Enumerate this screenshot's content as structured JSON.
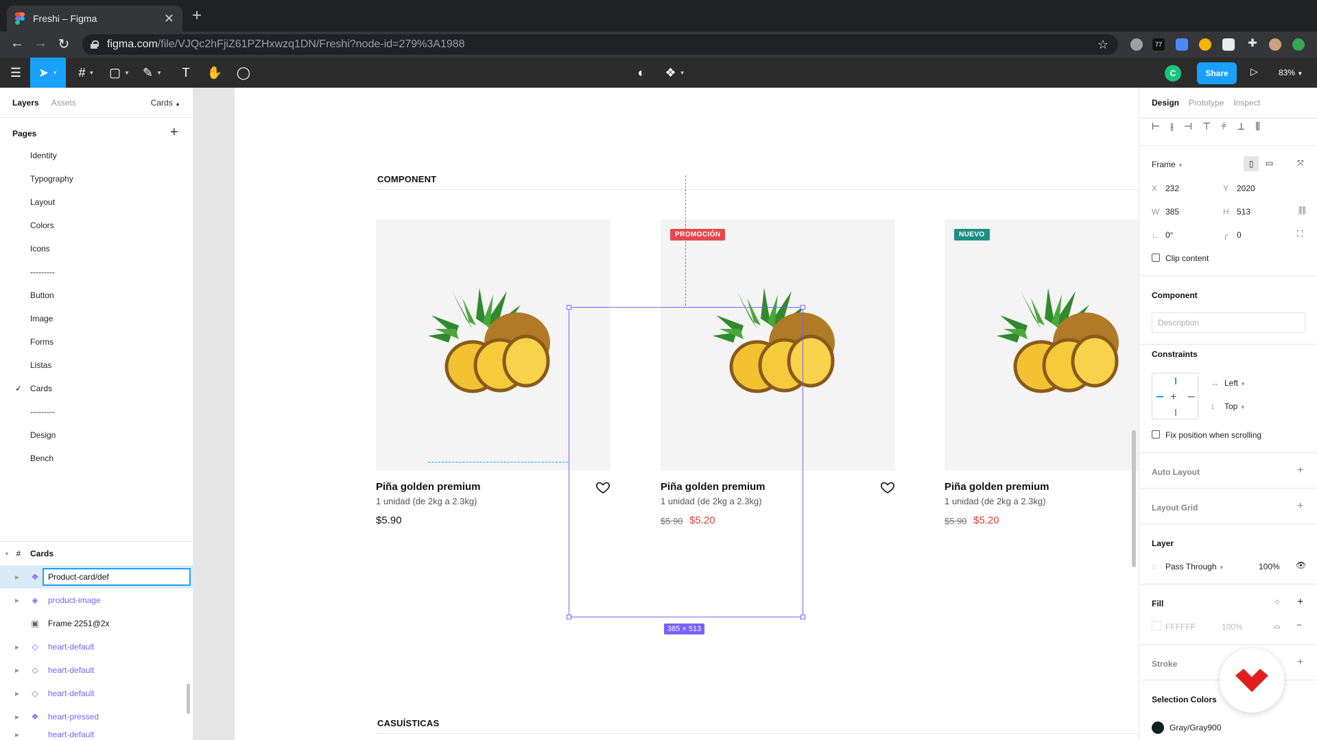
{
  "browser": {
    "tab_title": "Freshi – Figma",
    "tab_close": "✕",
    "new_tab": "+",
    "url_domain": "figma.com",
    "url_path": "/file/VJQc2hFjiZ61PZHxwzq1DN/Freshi?node-id=279%3A1988",
    "ext_badge": "77"
  },
  "toolbar": {
    "avatar_initial": "C",
    "share_label": "Share",
    "zoom_label": "83%"
  },
  "left_panel": {
    "tab_layers": "Layers",
    "tab_assets": "Assets",
    "current_page": "Cards",
    "pages_heading": "Pages",
    "pages": [
      "Identity",
      "Typography",
      "Layout",
      "Colors",
      "Icons",
      "---------",
      "Button",
      "Image",
      "Forms",
      "Listas",
      "Cards",
      "---------",
      "Design",
      "Bench"
    ],
    "active_page_check": "✓",
    "layers": {
      "frame_name": "Cards",
      "editing_value": "Product-card/def",
      "items": [
        "product-image",
        "Frame 2251@2x",
        "heart-default",
        "heart-default",
        "heart-default",
        "heart-pressed",
        "heart-default"
      ]
    }
  },
  "canvas": {
    "section_component": "COMPONENT",
    "section_casuisticas": "CASUÍSTICAS",
    "selection_dims": "385 × 513",
    "cards": [
      {
        "badge": "",
        "name": "Piña golden premium",
        "unit": "1 unidad (de 2kg a 2.3kg)",
        "price": "$5.90",
        "old_price": "",
        "new_price": ""
      },
      {
        "badge": "PROMOCIÓN",
        "badge_color": "#e5484d",
        "name": "Piña golden premium",
        "unit": "1 unidad (de 2kg a 2.3kg)",
        "price": "",
        "old_price": "$5.90",
        "new_price": "$5.20"
      },
      {
        "badge": "NUEVO",
        "badge_color": "#1f8f83",
        "name": "Piña golden premium",
        "unit": "1 unidad (de 2kg a 2.3kg)",
        "price": "",
        "old_price": "$5.90",
        "new_price": "$5.20"
      }
    ]
  },
  "right_panel": {
    "tab_design": "Design",
    "tab_prototype": "Prototype",
    "tab_inspect": "Inspect",
    "frame_label": "Frame",
    "x_label": "X",
    "x_value": "232",
    "y_label": "Y",
    "y_value": "2020",
    "w_label": "W",
    "w_value": "385",
    "h_label": "H",
    "h_value": "513",
    "rotation_value": "0°",
    "radius_value": "0",
    "clip_content": "Clip content",
    "component_heading": "Component",
    "description_placeholder": "Description",
    "constraints_heading": "Constraints",
    "constraint_h": "Left",
    "constraint_v": "Top",
    "fix_position": "Fix position when scrolling",
    "auto_layout": "Auto Layout",
    "layout_grid": "Layout Grid",
    "layer_heading": "Layer",
    "blend_mode": "Pass Through",
    "layer_opacity": "100%",
    "fill_heading": "Fill",
    "fill_hex": "FFFFFF",
    "fill_opacity": "100%",
    "stroke_heading": "Stroke",
    "selection_colors": "Selection Colors",
    "selection_color_name": "Gray/Gray900"
  }
}
